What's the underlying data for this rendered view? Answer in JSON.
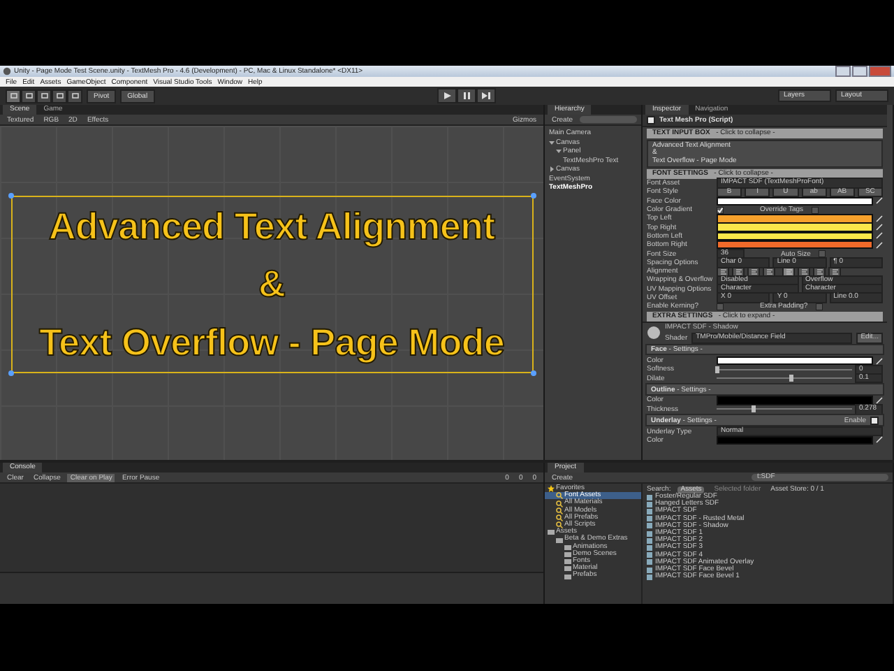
{
  "window": {
    "title": "Unity - Page Mode Test Scene.unity - TextMesh Pro - 4.6 (Development) - PC, Mac & Linux Standalone* <DX11>"
  },
  "menu": [
    "File",
    "Edit",
    "Assets",
    "GameObject",
    "Component",
    "Visual Studio Tools",
    "Window",
    "Help"
  ],
  "toolbar": {
    "tools": [
      {
        "selected": true
      },
      {
        "selected": false
      },
      {
        "selected": false
      },
      {
        "selected": false
      },
      {
        "selected": false
      }
    ],
    "pivot": "Pivot",
    "space": "Global",
    "layers": "Layers",
    "layout": "Layout"
  },
  "view": {
    "tabs": [
      {
        "label": "Scene",
        "selected": true
      },
      {
        "label": "Game",
        "selected": false
      }
    ],
    "toolbar": [
      "Textured",
      "RGB",
      "2D",
      "Effects"
    ],
    "gizmos": "Gizmos",
    "lines": [
      "Advanced Text Alignment",
      "&",
      "Text Overflow - Page Mode"
    ]
  },
  "hierarchy": {
    "title": "Hierarchy",
    "create": "Create",
    "items": [
      {
        "label": "Main Camera",
        "selected": false
      },
      {
        "label": "Canvas",
        "selected": false,
        "expanded": true,
        "children": [
          {
            "label": "Panel",
            "selected": false,
            "expanded": true,
            "children": [
              {
                "label": "TextMeshPro Text",
                "selected": false
              }
            ]
          }
        ]
      },
      {
        "label": "Canvas",
        "selected": false,
        "expanded": false
      },
      {
        "label": "EventSystem",
        "selected": false
      },
      {
        "label": "TextMeshPro",
        "selected": true
      }
    ]
  },
  "inspector": {
    "tabs": [
      {
        "label": "Inspector",
        "selected": true
      },
      {
        "label": "Navigation",
        "selected": false
      }
    ],
    "component": "Text Mesh Pro (Script)",
    "enabled": true,
    "blocks": [
      {
        "kind": "section",
        "title": "TEXT INPUT BOX",
        "hint": "- Click to collapse -"
      },
      {
        "kind": "textbox",
        "lines": [
          "Advanced Text Alignment",
          "&",
          "Text Overflow - Page Mode"
        ]
      },
      {
        "kind": "section",
        "title": "FONT SETTINGS",
        "hint": "- Click to collapse -"
      },
      {
        "kind": "field",
        "label": "Font Asset",
        "value": "IMPACT SDF (TextMeshProFont)"
      },
      {
        "kind": "buttons",
        "label": "Font Style",
        "buttons": [
          "B",
          "I",
          "U",
          "ab",
          "AB",
          "SC"
        ]
      },
      {
        "kind": "color",
        "label": "Face Color",
        "color": "#ffffff"
      },
      {
        "kind": "check",
        "label": "Color Gradient",
        "checked": true,
        "extra_label": "Override Tags",
        "extra_checked": false
      },
      {
        "kind": "color",
        "label": "Top Left",
        "color": "#f7a12c"
      },
      {
        "kind": "color",
        "label": "Top Right",
        "color": "#fbe64a"
      },
      {
        "kind": "color",
        "label": "Bottom Left",
        "color": "#fbe64a"
      },
      {
        "kind": "color",
        "label": "Bottom Right",
        "color": "#f06a2a"
      },
      {
        "kind": "check",
        "label": "Font Size",
        "value": "36",
        "extra_label": "Auto Size",
        "extra_checked": false
      },
      {
        "kind": "fields",
        "label": "Spacing Options",
        "fields": [
          "Char  0",
          "Line  0",
          "¶  0"
        ]
      },
      {
        "kind": "align",
        "label": "Alignment",
        "items": [
          {
            "selected": false
          },
          {
            "selected": false
          },
          {
            "selected": false
          },
          {
            "selected": false
          },
          {
            "selected": true
          },
          {
            "selected": false
          },
          {
            "selected": false
          },
          {
            "selected": false
          }
        ]
      },
      {
        "kind": "dropdowns",
        "label": "Wrapping & Overflow",
        "options": [
          "Disabled",
          "Overflow"
        ]
      },
      {
        "kind": "dropdowns",
        "label": "UV Mapping Options",
        "options": [
          "Character",
          "Character"
        ]
      },
      {
        "kind": "fields",
        "label": "UV Offset",
        "fields": [
          "X  0",
          "Y  0",
          "Line  0.0"
        ]
      },
      {
        "kind": "check",
        "label": "Enable Kerning?",
        "checked": false,
        "extra_label": "Extra Padding?",
        "extra_checked": false
      },
      {
        "kind": "section",
        "title": "EXTRA SETTINGS",
        "hint": "- Click to expand -"
      },
      {
        "kind": "material",
        "name": "IMPACT SDF - Shadow",
        "shader_label": "Shader",
        "shader": "TMPro/Mobile/Distance Field",
        "button": "Edit..."
      },
      {
        "kind": "sub",
        "title": "Face",
        "hint": "- Settings -"
      },
      {
        "kind": "color",
        "label": "Color",
        "color": "#ffffff"
      },
      {
        "kind": "slider",
        "label": "Softness",
        "level": 0.0,
        "value": "0"
      },
      {
        "kind": "slider",
        "label": "Dilate",
        "level": 0.55,
        "value": "0.1"
      },
      {
        "kind": "sub",
        "title": "Outline",
        "hint": "- Settings -"
      },
      {
        "kind": "color",
        "label": "Color",
        "color": "#000000"
      },
      {
        "kind": "slider",
        "label": "Thickness",
        "level": 0.27,
        "value": "0.278"
      },
      {
        "kind": "sub",
        "title": "Underlay",
        "hint": "- Settings -",
        "enable_label": "Enable",
        "enabled": true
      },
      {
        "kind": "dropdowns",
        "label": "Underlay Type",
        "options": [
          "Normal"
        ]
      },
      {
        "kind": "color",
        "label": "Color",
        "color": "#000000"
      }
    ]
  },
  "console": {
    "title": "Console",
    "buttons": [
      {
        "label": "Clear",
        "selected": false
      },
      {
        "label": "Collapse",
        "selected": false
      },
      {
        "label": "Clear on Play",
        "selected": true
      },
      {
        "label": "Error Pause",
        "selected": false
      }
    ],
    "counts": [
      "0",
      "0",
      "0"
    ]
  },
  "project": {
    "title": "Project",
    "create": "Create",
    "search": "t:SDF",
    "tree": [
      {
        "label": "Favorites",
        "kind": "star",
        "expanded": true,
        "children": [
          {
            "label": "Font Assets",
            "kind": "search",
            "selected": true
          },
          {
            "label": "All Materials",
            "kind": "search",
            "selected": false
          },
          {
            "label": "All Models",
            "kind": "search",
            "selected": false
          },
          {
            "label": "All Prefabs",
            "kind": "search",
            "selected": false
          },
          {
            "label": "All Scripts",
            "kind": "search",
            "selected": false
          }
        ]
      },
      {
        "label": "Assets",
        "kind": "folder",
        "expanded": true,
        "children": [
          {
            "label": "Beta & Demo Extras",
            "kind": "folder",
            "expanded": true,
            "children": [
              {
                "label": "Animations",
                "kind": "folder"
              },
              {
                "label": "Demo Scenes",
                "kind": "folder"
              },
              {
                "label": "Fonts",
                "kind": "folder"
              },
              {
                "label": "Material",
                "kind": "folder"
              },
              {
                "label": "Prefabs",
                "kind": "folder"
              }
            ]
          }
        ]
      }
    ],
    "search_label": "Search:",
    "scopes": [
      {
        "label": "Assets",
        "selected": true
      },
      {
        "label": "Selected folder",
        "selected": false
      }
    ],
    "asset_store": "Asset Store: 0 / 1",
    "results": [
      "Foster/Regular SDF",
      "Hanged Letters SDF",
      "IMPACT SDF",
      "IMPACT SDF - Rusted Metal",
      "IMPACT SDF - Shadow",
      "IMPACT SDF 1",
      "IMPACT SDF 2",
      "IMPACT SDF 3",
      "IMPACT SDF 4",
      "IMPACT SDF Animated Overlay",
      "IMPACT SDF Face Bevel",
      "IMPACT SDF Face Bevel 1"
    ]
  }
}
